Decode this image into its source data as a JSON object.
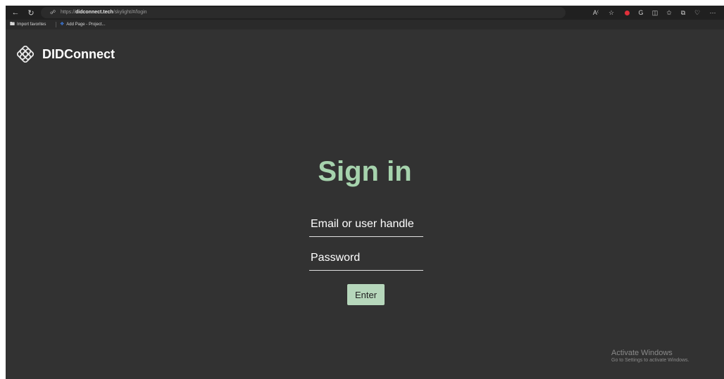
{
  "browser": {
    "url_scheme": "https://",
    "url_host": "didconnect.tech",
    "url_path": "/skylight/#/login",
    "bookmarks": [
      {
        "label": "Import favorites"
      },
      {
        "label": "Add Page - Project..."
      }
    ]
  },
  "app": {
    "brand_name": "DIDConnect",
    "title": "Sign in",
    "email_placeholder": "Email or user handle",
    "password_placeholder": "Password",
    "enter_label": "Enter"
  },
  "os_watermark": {
    "title": "Activate Windows",
    "subtitle": "Go to Settings to activate Windows."
  },
  "colors": {
    "accent": "#a6d3ad",
    "button_bg": "#b6d7bb",
    "background": "#323232"
  }
}
